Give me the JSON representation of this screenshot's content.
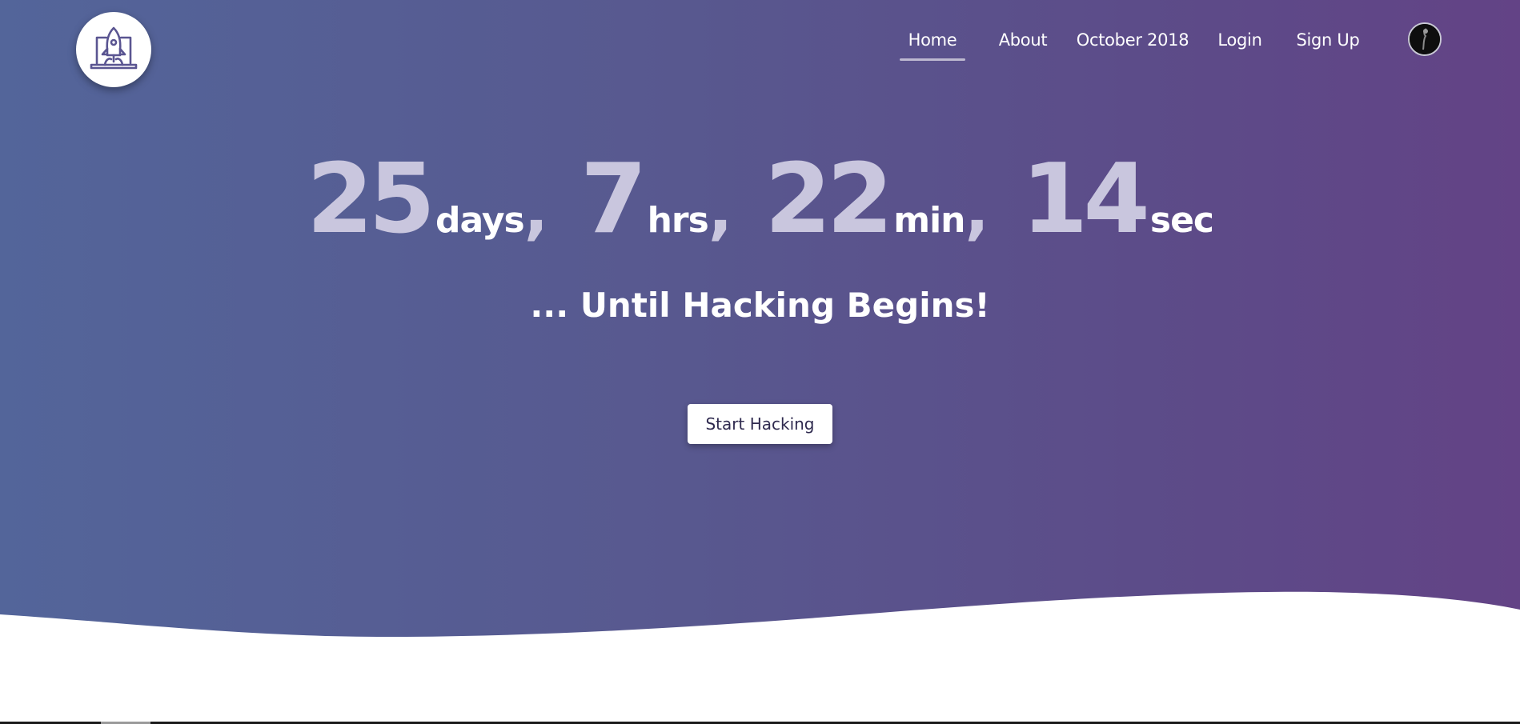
{
  "nav": {
    "items": [
      {
        "label": "Home",
        "active": true
      },
      {
        "label": "About",
        "active": false
      },
      {
        "label": "October 2018",
        "active": false
      },
      {
        "label": "Login",
        "active": false
      },
      {
        "label": "Sign Up",
        "active": false
      }
    ]
  },
  "countdown": {
    "days": "25",
    "days_unit": "days",
    "hours": "7",
    "hours_unit": "hrs",
    "minutes": "22",
    "minutes_unit": "min",
    "seconds": "14",
    "seconds_unit": "sec",
    "separator": ","
  },
  "tagline": "... Until Hacking Begins!",
  "cta": {
    "label": "Start Hacking"
  },
  "icons": {
    "logo": "rocket-laptop-icon",
    "avatar": "user-avatar"
  },
  "colors": {
    "gradient_start": "#53659a",
    "gradient_end": "#634386",
    "number_color": "#c9c6de",
    "logo_stroke": "#5a5591"
  }
}
